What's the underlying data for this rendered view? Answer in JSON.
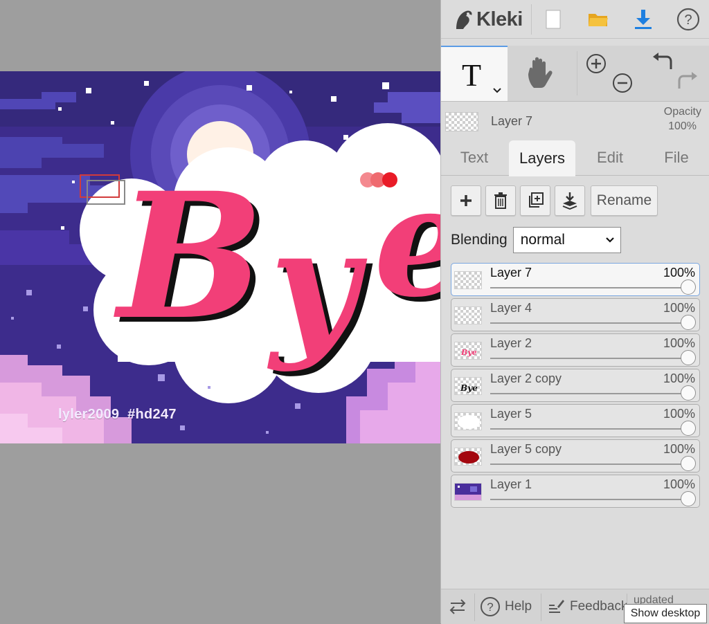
{
  "canvas": {
    "watermark_user": "lyler2009",
    "watermark_tag": "#hd247"
  },
  "header": {
    "app_name": "Kleki",
    "icons": [
      "new-image-icon",
      "open-folder-icon",
      "download-icon",
      "help-icon"
    ]
  },
  "tools": {
    "text_tool_glyph": "T",
    "active": "text"
  },
  "layer_info": {
    "name": "Layer 7",
    "opacity_label": "Opacity",
    "opacity_value": "100%"
  },
  "tabs": [
    "Text",
    "Layers",
    "Edit",
    "File"
  ],
  "active_tab": "Layers",
  "layer_tools": {
    "rename_label": "Rename"
  },
  "blending": {
    "label": "Blending",
    "value": "normal"
  },
  "layers": [
    {
      "name": "Layer 7",
      "opacity": "100%",
      "opacity_fraction": 1.0,
      "selected": true
    },
    {
      "name": "Layer 4",
      "opacity": "100%",
      "opacity_fraction": 1.0,
      "selected": false
    },
    {
      "name": "Layer 2",
      "opacity": "100%",
      "opacity_fraction": 1.0,
      "selected": false
    },
    {
      "name": "Layer 2 copy",
      "opacity": "100%",
      "opacity_fraction": 1.0,
      "selected": false
    },
    {
      "name": "Layer 5",
      "opacity": "100%",
      "opacity_fraction": 1.0,
      "selected": false
    },
    {
      "name": "Layer 5 copy",
      "opacity": "100%",
      "opacity_fraction": 1.0,
      "selected": false
    },
    {
      "name": "Layer 1",
      "opacity": "100%",
      "opacity_fraction": 1.0,
      "selected": false
    }
  ],
  "footer": {
    "help": "Help",
    "feedback": "Feedback",
    "updated": "updated",
    "tooltip": "Show desktop"
  },
  "colors": {
    "accent": "#5b9be5",
    "download_blue": "#1e7fe0",
    "folder_yellow": "#f5b82e",
    "text_pink": "#f23f78"
  }
}
